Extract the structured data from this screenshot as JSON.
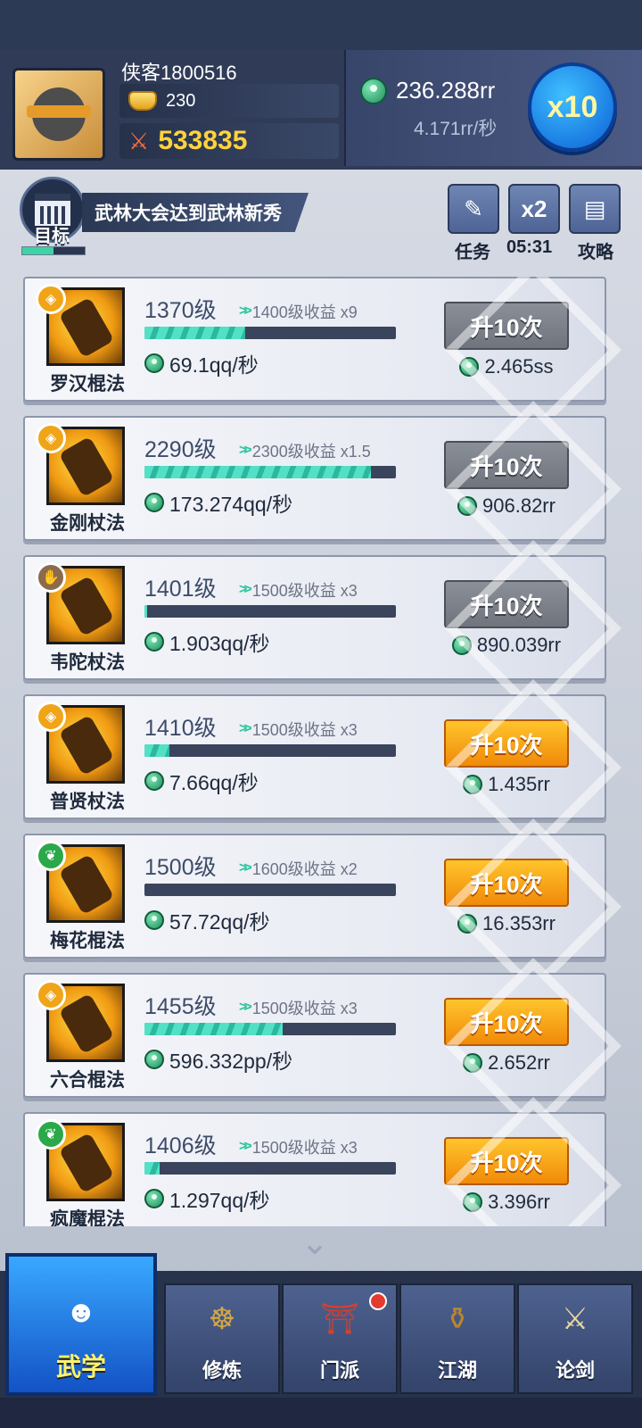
{
  "player": {
    "name": "侠客1800516",
    "gold": "230",
    "power": "533835"
  },
  "money": {
    "amount": "236.288rr",
    "rate": "4.171rr/秒",
    "multiplier_btn": "x10"
  },
  "goal": {
    "label": "目标",
    "text": "武林大会达到武林新秀",
    "progress": 0.5
  },
  "tools": {
    "task_label": "任务",
    "boost_btn": "x2",
    "boost_timer": "05:31",
    "guide_label": "攻略"
  },
  "skills": [
    {
      "name": "罗汉棍法",
      "level": "1370级",
      "next": "1400级收益 x9",
      "progress": 0.4,
      "income": "69.1qq/秒",
      "btn": "升10次",
      "btn_state": "disabled",
      "cost": "2.465ss",
      "badge": "gold"
    },
    {
      "name": "金刚杖法",
      "level": "2290级",
      "next": "2300级收益 x1.5",
      "progress": 0.9,
      "income": "173.274qq/秒",
      "btn": "升10次",
      "btn_state": "disabled",
      "cost": "906.82rr",
      "badge": "gold"
    },
    {
      "name": "韦陀杖法",
      "level": "1401级",
      "next": "1500级收益 x3",
      "progress": 0.01,
      "income": "1.903qq/秒",
      "btn": "升10次",
      "btn_state": "disabled",
      "cost": "890.039rr",
      "badge": "brown"
    },
    {
      "name": "普贤杖法",
      "level": "1410级",
      "next": "1500级收益 x3",
      "progress": 0.1,
      "income": "7.66qq/秒",
      "btn": "升10次",
      "btn_state": "enabled",
      "cost": "1.435rr",
      "badge": "gold"
    },
    {
      "name": "梅花棍法",
      "level": "1500级",
      "next": "1600级收益 x2",
      "progress": 0.0,
      "income": "57.72qq/秒",
      "btn": "升10次",
      "btn_state": "enabled",
      "cost": "16.353rr",
      "badge": "green"
    },
    {
      "name": "六合棍法",
      "level": "1455级",
      "next": "1500级收益 x3",
      "progress": 0.55,
      "income": "596.332pp/秒",
      "btn": "升10次",
      "btn_state": "enabled",
      "cost": "2.652rr",
      "badge": "gold"
    },
    {
      "name": "疯魔棍法",
      "level": "1406级",
      "next": "1500级收益 x3",
      "progress": 0.06,
      "income": "1.297qq/秒",
      "btn": "升10次",
      "btn_state": "enabled",
      "cost": "3.396rr",
      "badge": "green"
    }
  ],
  "nav": [
    {
      "label": "武学",
      "active": true,
      "icon": "ninja-icon"
    },
    {
      "label": "修炼",
      "active": false,
      "icon": "meditation-icon"
    },
    {
      "label": "门派",
      "active": false,
      "icon": "temple-icon",
      "dot": true
    },
    {
      "label": "江湖",
      "active": false,
      "icon": "gourd-icon"
    },
    {
      "label": "论剑",
      "active": false,
      "icon": "sword-icon"
    }
  ]
}
